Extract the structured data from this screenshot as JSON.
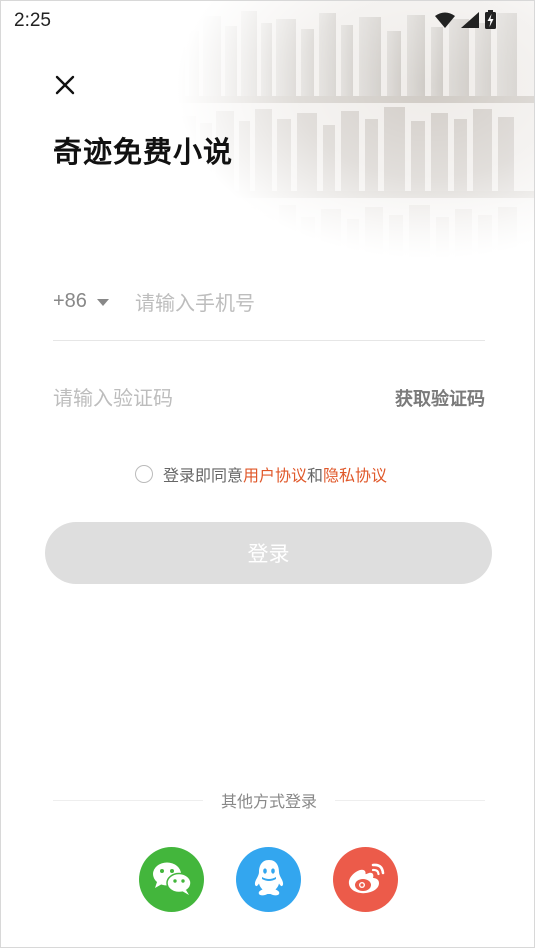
{
  "status_bar": {
    "time": "2:25",
    "icons": [
      "wifi-icon",
      "cellular-signal-icon",
      "battery-charging-icon"
    ]
  },
  "header": {
    "close_icon": "close-icon",
    "app_title": "奇迹免费小说"
  },
  "login_form": {
    "country_code": "+86",
    "phone_placeholder": "请输入手机号",
    "phone_value": "",
    "code_placeholder": "请输入验证码",
    "code_value": "",
    "get_code_label": "获取验证码",
    "agreement_prefix": "登录即同意",
    "user_agreement_link": "用户协议",
    "agreement_and": "和",
    "privacy_policy_link": "隐私协议",
    "agreement_checked": false,
    "login_label": "登录"
  },
  "other_login": {
    "label": "其他方式登录",
    "providers": [
      "wechat-icon",
      "qq-icon",
      "weibo-icon"
    ]
  },
  "colors": {
    "link": "#e0582a",
    "login_button_disabled": "#dedede",
    "wechat": "#43b63c",
    "qq": "#33a6ef",
    "weibo": "#ec5b4a"
  }
}
